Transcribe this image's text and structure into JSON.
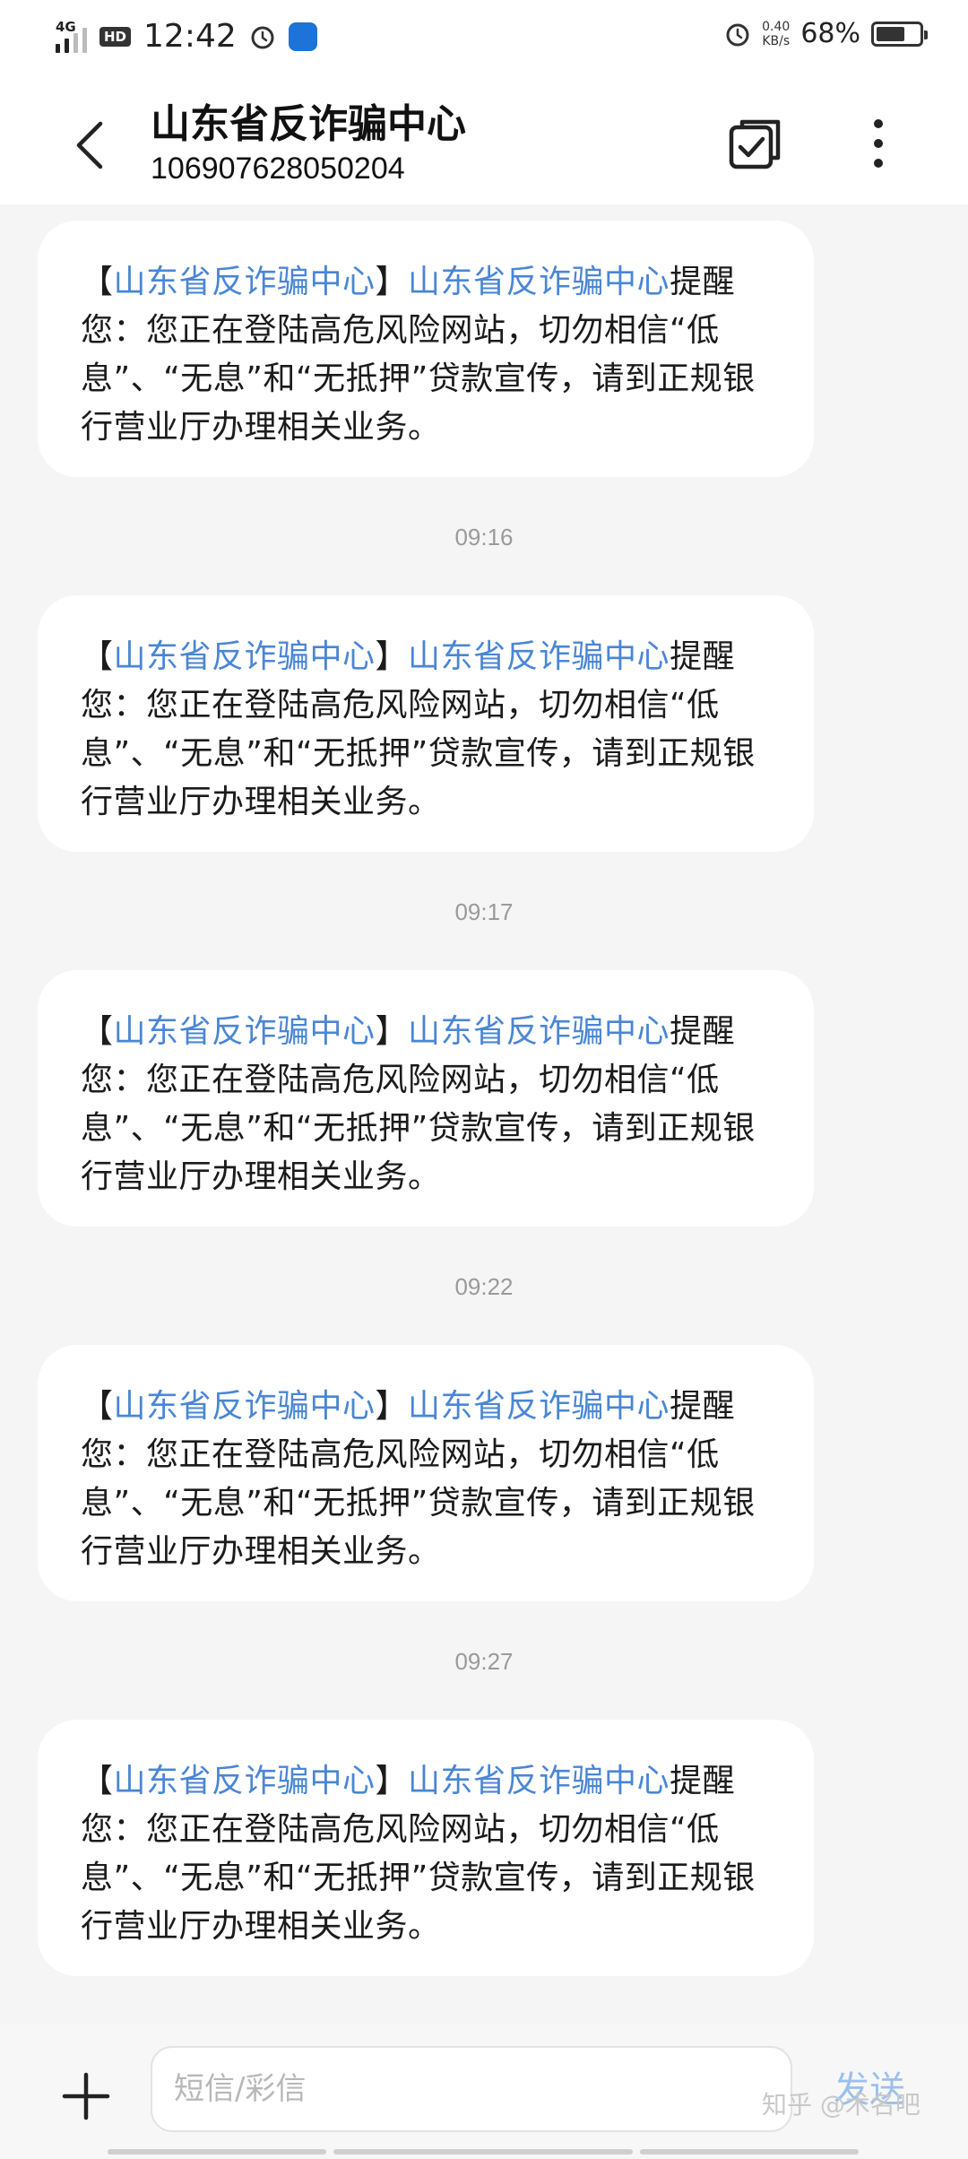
{
  "status_bar": {
    "network": "4G",
    "hd": "HD",
    "time": "12:42",
    "speed_value": "0.40",
    "speed_unit": "KB/s",
    "battery_percent": "68%",
    "battery_level": 0.68
  },
  "header": {
    "title": "山东省反诈骗中心",
    "number": "106907628050204"
  },
  "messages": [
    {
      "link1": "山东省反诈骗中心",
      "link2": "山东省反诈骗中心",
      "prefix": "【",
      "mid": "】",
      "body": "提醒您：您正在登陆高危风险网站，切勿相信“低息”、“无息”和“无抵押”贷款宣传，请到正规银行营业厅办理相关业务。"
    },
    {
      "link1": "山东省反诈骗中心",
      "link2": "山东省反诈骗中心",
      "prefix": "【",
      "mid": "】",
      "body": "提醒您：您正在登陆高危风险网站，切勿相信“低息”、“无息”和“无抵押”贷款宣传，请到正规银行营业厅办理相关业务。"
    },
    {
      "link1": "山东省反诈骗中心",
      "link2": "山东省反诈骗中心",
      "prefix": "【",
      "mid": "】",
      "body": "提醒您：您正在登陆高危风险网站，切勿相信“低息”、“无息”和“无抵押”贷款宣传，请到正规银行营业厅办理相关业务。"
    },
    {
      "link1": "山东省反诈骗中心",
      "link2": "山东省反诈骗中心",
      "prefix": "【",
      "mid": "】",
      "body": "提醒您：您正在登陆高危风险网站，切勿相信“低息”、“无息”和“无抵押”贷款宣传，请到正规银行营业厅办理相关业务。"
    },
    {
      "link1": "山东省反诈骗中心",
      "link2": "山东省反诈骗中心",
      "prefix": "【",
      "mid": "】",
      "body": "提醒您：您正在登陆高危风险网站，切勿相信“低息”、“无息”和“无抵押”贷款宣传，请到正规银行营业厅办理相关业务。"
    }
  ],
  "timestamps": [
    "09:16",
    "09:17",
    "09:22",
    "09:27"
  ],
  "compose": {
    "placeholder": "短信/彩信",
    "send_label": "发送"
  },
  "watermark": "知乎 @术名吧",
  "icons": {
    "back": "back-arrow-icon",
    "select": "checkbox-select-icon",
    "more": "more-vertical-icon",
    "add": "plus-icon",
    "alarm": "alarm-clock-icon"
  },
  "colors": {
    "link": "#4a86d4",
    "background": "#f5f5f5",
    "bubble": "#ffffff",
    "send_disabled": "#9cc0ec"
  }
}
